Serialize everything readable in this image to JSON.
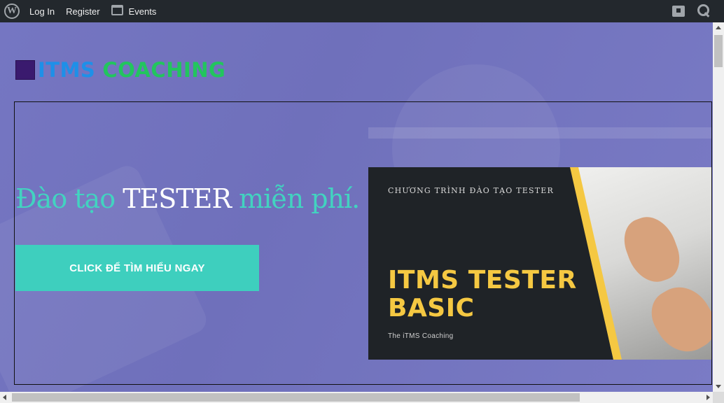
{
  "adminbar": {
    "login_label": "Log In",
    "register_label": "Register",
    "events_label": "Events"
  },
  "logo": {
    "part1": "ITMS",
    "part2": "COACHING"
  },
  "hero": {
    "headline_part1": "Đào tạo",
    "headline_part2": "TESTER",
    "headline_part3": "miễn phí.",
    "cta_label": "CLICK ĐỂ TÌM HIỂU NGAY"
  },
  "banner": {
    "kicker": "CHƯƠNG TRÌNH ĐÀO TẠO TESTER",
    "title_line1": "ITMS TESTER",
    "title_line2": "BASIC",
    "brand": "The iTMS Coaching"
  },
  "colors": {
    "accent_teal": "#3ecfbe",
    "hero_bg": "#7374c0",
    "banner_yellow": "#f5c842"
  }
}
